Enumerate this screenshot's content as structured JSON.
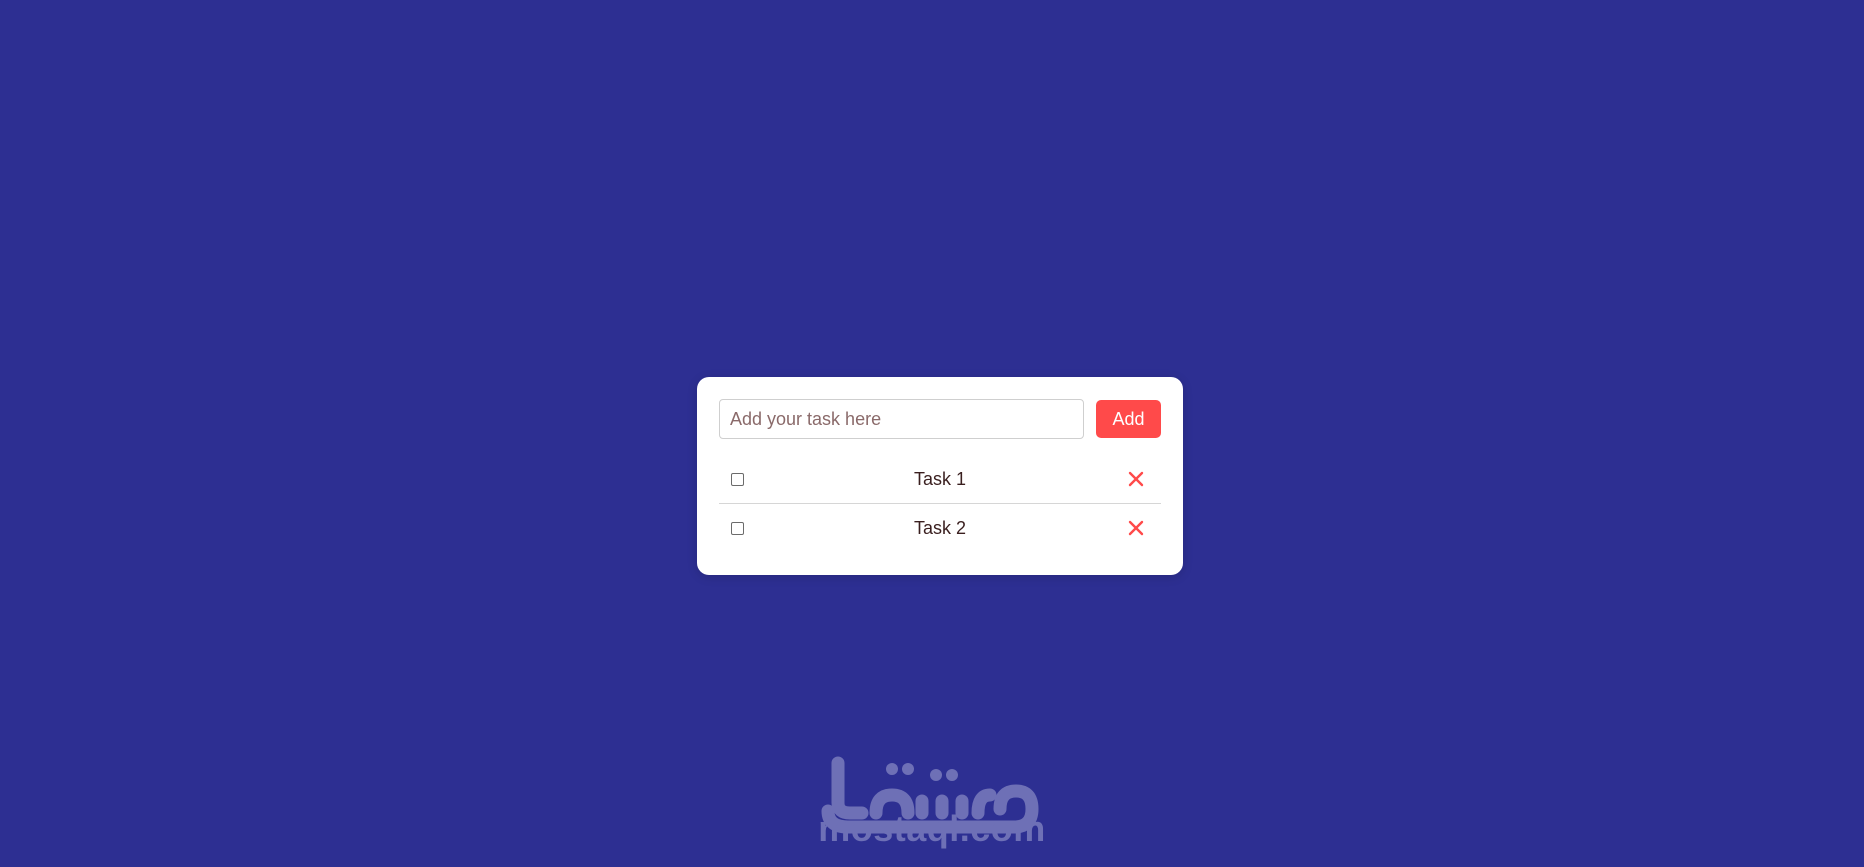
{
  "todo": {
    "input": {
      "value": "",
      "placeholder": "Add your task here"
    },
    "add_button_label": "Add",
    "tasks": [
      {
        "label": "Task 1",
        "checked": false,
        "delete_icon": "close-icon"
      },
      {
        "label": "Task 2",
        "checked": false,
        "delete_icon": "close-icon"
      }
    ]
  },
  "watermark": {
    "arabic": "مستقل",
    "latin": "mostaql.com"
  },
  "colors": {
    "background": "#2d2f92",
    "accent": "#ff4a4a",
    "card": "#ffffff",
    "watermark": "#6e70b6"
  }
}
